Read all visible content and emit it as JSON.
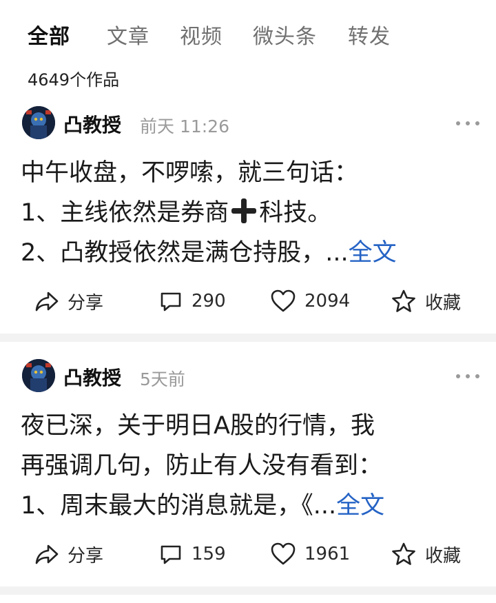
{
  "tabs": [
    {
      "label": "全部",
      "active": true
    },
    {
      "label": "文章",
      "active": false
    },
    {
      "label": "视频",
      "active": false
    },
    {
      "label": "微头条",
      "active": false
    },
    {
      "label": "转发",
      "active": false
    }
  ],
  "works_count": "4649个作品",
  "posts": [
    {
      "author": "凸教授",
      "time": "前天  11:26",
      "lines": [
        "中午收盘，不啰嗦，就三句话：",
        "1、主线依然是券商",
        "科技。",
        "2、凸教授依然是满仓持股，..."
      ],
      "full_text_label": "全文",
      "share_label": "分享",
      "comments": "290",
      "likes": "2094",
      "favorite_label": "收藏"
    },
    {
      "author": "凸教授",
      "time": "5天前",
      "lines": [
        "夜已深，关于明日A股的行情，我",
        "再强调几句，防止有人没有看到：",
        "1、周末最大的消息就是，《..."
      ],
      "full_text_label": "全文",
      "share_label": "分享",
      "comments": "159",
      "likes": "1961",
      "favorite_label": "收藏"
    }
  ],
  "icons": {
    "share": "share-icon",
    "comment": "comment-icon",
    "like": "heart-icon",
    "favorite": "star-icon",
    "more": "more-icon"
  },
  "colors": {
    "link": "#2563c5",
    "muted": "#9a9a9a",
    "divider": "#f2f2f2"
  }
}
